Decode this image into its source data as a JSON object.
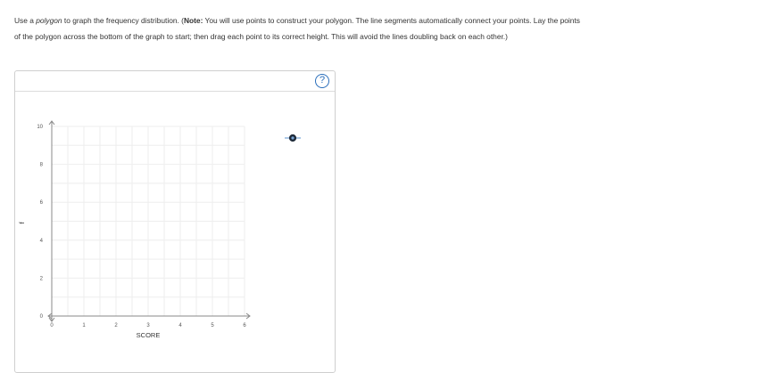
{
  "instructions": {
    "part1": "Use a ",
    "polygon_word": "polygon",
    "part2": " to graph the frequency distribution. (",
    "note_word": "Note:",
    "part3": " You will use points to construct your polygon. The line segments automatically connect your points. Lay the points of the polygon across the bottom of the graph to start; then drag each point to its correct height. This will avoid the lines doubling back on each other.)"
  },
  "help_button": {
    "label": "?"
  },
  "graph": {
    "x_axis_title": "SCORE",
    "y_axis_title": "f",
    "x_range": [
      0,
      6
    ],
    "y_range": [
      0,
      10
    ],
    "x_ticks": [
      "0",
      "1",
      "2",
      "3",
      "4",
      "5",
      "6"
    ],
    "y_ticks": [
      "0",
      "2",
      "4",
      "6",
      "8",
      "10"
    ],
    "grid": true,
    "grid_color": "#eeeeee",
    "axis_color": "#888888",
    "accent_color": "#2a6ebb"
  },
  "tools": {
    "point_tool_icon": "point-tool-icon"
  }
}
